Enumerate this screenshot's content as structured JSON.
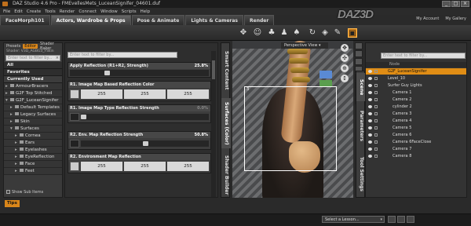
{
  "app": {
    "title": "DAZ Studio 4.6 Pro - FMEvellesMets_LuceanSignifer_04601.duf",
    "logo": "DAZ3D",
    "logo_badge": "3D",
    "window_buttons": [
      "_",
      "□",
      "×"
    ]
  },
  "menu": [
    "File",
    "Edit",
    "Create",
    "Tools",
    "Render",
    "Connect",
    "Window",
    "Scripts",
    "Help"
  ],
  "top_links": [
    "My Account",
    "My Gallery"
  ],
  "tabs": [
    {
      "label": "FaceMorph101",
      "active": false
    },
    {
      "label": "Actors, Wardrobe & Props",
      "active": true
    },
    {
      "label": "Pose & Animate",
      "active": false
    },
    {
      "label": "Lights & Cameras",
      "active": false
    },
    {
      "label": "Render",
      "active": false
    }
  ],
  "left_panel": {
    "subtabs": [
      "Presets",
      "Editor",
      "Shader Baker"
    ],
    "active_subtab": "Editor",
    "shader_label": "Shader: V3D_AGBG3_FSkin",
    "filter_placeholder": "Enter text to filter by...",
    "categories": [
      "All",
      "Favorites",
      "Currently Used"
    ],
    "tree": [
      {
        "label": "ArmourBracers",
        "indent": 0,
        "expanded": false
      },
      {
        "label": "G2F Top Stitched",
        "indent": 0,
        "expanded": false
      },
      {
        "label": "G2F_LuceanSignifer",
        "indent": 0,
        "expanded": true
      },
      {
        "label": "Default Templates",
        "indent": 1,
        "expanded": false
      },
      {
        "label": "Legacy Surfaces",
        "indent": 1,
        "expanded": false
      },
      {
        "label": "Skin",
        "indent": 1,
        "expanded": false
      },
      {
        "label": "Surfaces",
        "indent": 1,
        "expanded": true
      },
      {
        "label": "Cornea",
        "indent": 2,
        "expanded": false
      },
      {
        "label": "Ears",
        "indent": 2,
        "expanded": false
      },
      {
        "label": "Eyelashes",
        "indent": 2,
        "expanded": false
      },
      {
        "label": "EyeReflection",
        "indent": 2,
        "expanded": false
      },
      {
        "label": "Face",
        "indent": 2,
        "expanded": false
      },
      {
        "label": "Feet",
        "indent": 2,
        "expanded": false
      }
    ],
    "show_sub_items": "Show Sub Items"
  },
  "properties": {
    "filter_placeholder": "Enter text to filter by...",
    "items": [
      {
        "title": "Apply Reflection (R1+R2, Strength)",
        "value": "25.8%",
        "type": "slider",
        "level": 0.258
      },
      {
        "title": "R1. Image Map Based Reflection Color",
        "value": "",
        "type": "rgb",
        "r": "255",
        "g": "255",
        "b": "255"
      },
      {
        "title": "R1. Image Map Type Reflection Strength",
        "value": "0.0%",
        "type": "slider",
        "level": 0.0
      },
      {
        "title": "R2. Env. Map Reflection Strength",
        "value": "50.8%",
        "type": "slider",
        "level": 0.508
      },
      {
        "title": "R2. Environment Map Reflection",
        "value": "",
        "type": "rgb",
        "r": "255",
        "g": "255",
        "b": "255"
      }
    ]
  },
  "vtabs_left": [
    "Smart Content",
    "Surfaces (Color)",
    "Shader Builder"
  ],
  "vtabs_right": [
    "Scene",
    "Parameters",
    "Tool Settings"
  ],
  "viewport": {
    "title": "Perspective View",
    "label": "3"
  },
  "scene": {
    "filter_placeholder": "Enter text to filter by...",
    "column": "Node",
    "nodes": [
      {
        "label": "G2F_LuceanSignifer",
        "indent": 1,
        "selected": true
      },
      {
        "label": "Level_10",
        "indent": 1,
        "selected": false
      },
      {
        "label": "Surfer Guy Lights",
        "indent": 1,
        "selected": false
      },
      {
        "label": "Camera 1",
        "indent": 2,
        "selected": false
      },
      {
        "label": "Camera 2",
        "indent": 2,
        "selected": false
      },
      {
        "label": "cylinder 2",
        "indent": 2,
        "selected": false
      },
      {
        "label": "Camera 3",
        "indent": 2,
        "selected": false
      },
      {
        "label": "Camera 4",
        "indent": 2,
        "selected": false
      },
      {
        "label": "Camera 5",
        "indent": 2,
        "selected": false
      },
      {
        "label": "Camera 6",
        "indent": 2,
        "selected": false
      },
      {
        "label": "Camera 6FaceClose",
        "indent": 2,
        "selected": false
      },
      {
        "label": "Camera 7",
        "indent": 2,
        "selected": false
      },
      {
        "label": "Camera 8",
        "indent": 2,
        "selected": false
      }
    ]
  },
  "status": {
    "tips": "Tips",
    "lesson": "Select a Lesson..."
  },
  "colors": {
    "accent": "#d9861a",
    "panel": "#3a3a3a",
    "selection": "#e08d15"
  }
}
